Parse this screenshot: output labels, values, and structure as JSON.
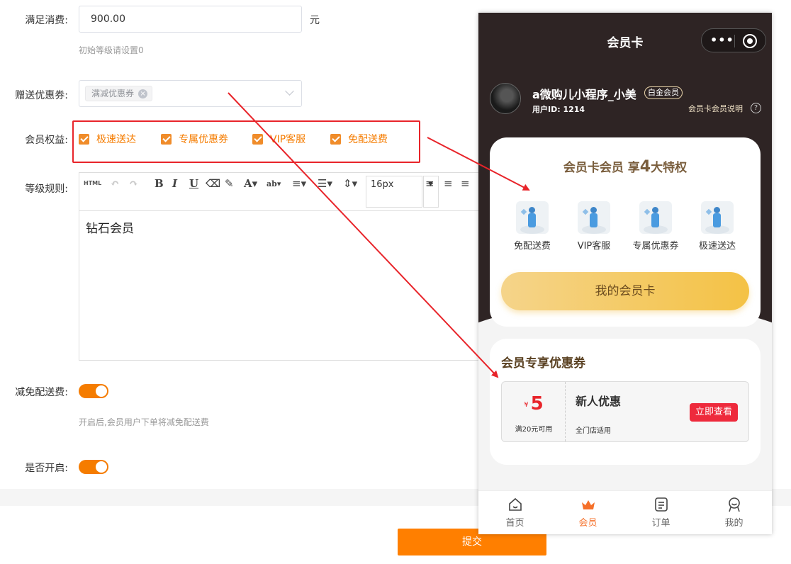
{
  "form": {
    "spend_label": "满足消费:",
    "spend_value": "900.00",
    "spend_unit": "元",
    "spend_hint": "初始等级请设置0",
    "coupon_label": "赠送优惠券:",
    "coupon_tag": "满减优惠券",
    "benefits_label": "会员权益:",
    "benefits": [
      "极速送达",
      "专属优惠券",
      "VIP客服",
      "免配送费"
    ],
    "rules_label": "等级规则:",
    "editor_html_btn": "HTML",
    "editor_font_size": "16px",
    "editor_content": "钻石会员",
    "delivery_label": "减免配送费:",
    "delivery_hint": "开启后,会员用户下单将减免配送费",
    "enabled_label": "是否开启:",
    "submit_label": "提交"
  },
  "phone": {
    "title": "会员卡",
    "capsule_dots": "•••",
    "user_name": "a微购儿小程序_小美",
    "user_badge": "白金会员",
    "user_id": "用户ID: 1214",
    "member_explain": "会员卡会员说明",
    "perks_title_prefix": "会员卡会员 享",
    "perks_title_count": "4",
    "perks_title_suffix": "大特权",
    "perks": [
      "免配送费",
      "VIP客服",
      "专属优惠券",
      "极速送达"
    ],
    "my_card_label": "我的会员卡",
    "coupons_title": "会员专享优惠券",
    "coupon": {
      "currency": "¥",
      "amount": "5",
      "condition": "满20元可用",
      "name": "新人优惠",
      "scope": "全门店适用",
      "action": "立即查看"
    },
    "tabs": [
      {
        "label": "首页",
        "icon": "home-icon"
      },
      {
        "label": "会员",
        "icon": "crown-icon"
      },
      {
        "label": "订单",
        "icon": "order-icon"
      },
      {
        "label": "我的",
        "icon": "profile-icon"
      }
    ],
    "active_tab": "会员"
  },
  "colors": {
    "accent": "#f57c00",
    "annotation_red": "#e8242a",
    "phone_header": "#2e2424",
    "gold": "#f4c245"
  }
}
